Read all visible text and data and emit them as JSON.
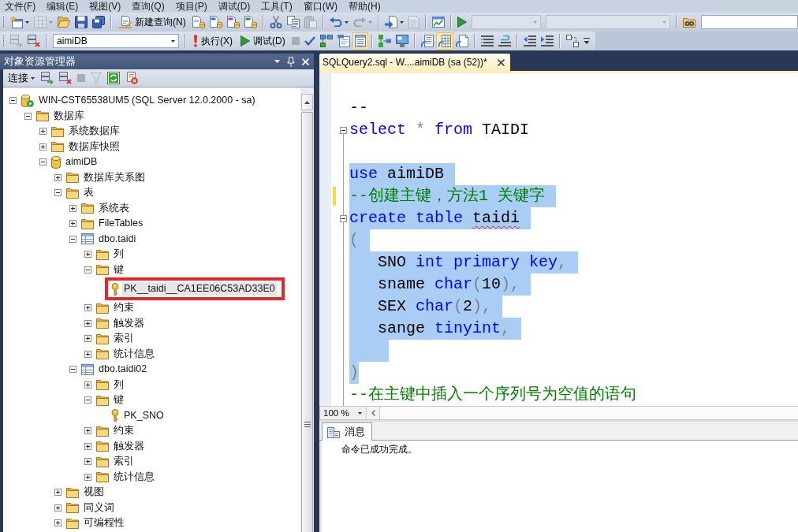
{
  "menu_bar": {
    "items": [
      "文件(F)",
      "编辑(E)",
      "视图(V)",
      "查询(Q)",
      "项目(P)",
      "调试(D)",
      "工具(T)",
      "窗口(W)",
      "帮助(H)"
    ]
  },
  "toolbar_1": {
    "items": [
      {
        "kind": "dropdown_icon",
        "disabled": false
      },
      {
        "kind": "dropdown_icon",
        "disabled": true
      },
      {
        "kind": "icon",
        "disabled": false
      },
      {
        "kind": "icon",
        "disabled": false
      },
      {
        "kind": "icon",
        "disabled": false
      },
      {
        "kind": "separator"
      },
      {
        "kind": "labeled",
        "label": "新建查询(N)",
        "disabled": false
      },
      {
        "kind": "icon",
        "disabled": false
      },
      {
        "kind": "icon",
        "disabled": false
      },
      {
        "kind": "icon",
        "disabled": false
      },
      {
        "kind": "icon",
        "disabled": false
      },
      {
        "kind": "separator"
      },
      {
        "kind": "icon",
        "disabled": false
      },
      {
        "kind": "icon",
        "disabled": false
      },
      {
        "kind": "icon",
        "disabled": true
      },
      {
        "kind": "separator"
      },
      {
        "kind": "dropdown_icon",
        "disabled": false
      },
      {
        "kind": "dropdown_icon",
        "disabled": true
      },
      {
        "kind": "separator"
      },
      {
        "kind": "dropdown_icon",
        "disabled": false
      },
      {
        "kind": "icon",
        "disabled": true
      },
      {
        "kind": "separator"
      },
      {
        "kind": "icon",
        "disabled": false
      },
      {
        "kind": "separator"
      },
      {
        "kind": "icon",
        "disabled": false
      },
      {
        "kind": "combo",
        "disabled": true
      },
      {
        "kind": "combo",
        "disabled": true
      },
      {
        "kind": "separator"
      },
      {
        "kind": "icon",
        "disabled": false
      },
      {
        "kind": "search"
      }
    ]
  },
  "toolbar_2": {
    "items": [
      {
        "kind": "icon",
        "disabled": true,
        "pressed": false
      },
      {
        "kind": "icon",
        "disabled": false,
        "pressed": false
      },
      {
        "kind": "separator"
      },
      {
        "kind": "combo",
        "value": "aimiDB",
        "disabled": false
      },
      {
        "kind": "separator"
      },
      {
        "kind": "labeled",
        "label": "执行(X)",
        "disabled": false
      },
      {
        "kind": "labeled",
        "label": "调试(D)",
        "disabled": false
      },
      {
        "kind": "icon",
        "disabled": true,
        "pressed": false
      },
      {
        "kind": "icon",
        "disabled": false,
        "pressed": false
      },
      {
        "kind": "icon",
        "disabled": false,
        "pressed": false
      },
      {
        "kind": "icon",
        "disabled": false,
        "pressed": false
      },
      {
        "kind": "icon",
        "disabled": false,
        "pressed": true
      },
      {
        "kind": "separator"
      },
      {
        "kind": "icon",
        "disabled": false,
        "pressed": false
      },
      {
        "kind": "icon",
        "disabled": false,
        "pressed": false
      },
      {
        "kind": "separator"
      },
      {
        "kind": "icon",
        "disabled": false,
        "pressed": false
      },
      {
        "kind": "icon",
        "disabled": false,
        "pressed": true
      },
      {
        "kind": "icon",
        "disabled": false,
        "pressed": false
      },
      {
        "kind": "separator"
      },
      {
        "kind": "icon",
        "disabled": false,
        "pressed": false
      },
      {
        "kind": "icon",
        "disabled": false,
        "pressed": false
      },
      {
        "kind": "separator"
      },
      {
        "kind": "icon",
        "disabled": false,
        "pressed": false
      },
      {
        "kind": "icon",
        "disabled": false,
        "pressed": false
      },
      {
        "kind": "separator"
      },
      {
        "kind": "icon",
        "disabled": false,
        "pressed": false
      },
      {
        "kind": "overflow"
      }
    ]
  },
  "object_explorer": {
    "title": "对象资源管理器",
    "connect": "连接",
    "buttons": [
      {
        "disabled": false
      },
      {
        "disabled": false
      },
      {
        "disabled": true
      },
      {
        "disabled": true
      },
      {
        "disabled": false
      },
      {
        "disabled": false
      }
    ],
    "tree": [
      {
        "label": "WIN-CST65538UM5 (SQL Server 12.0.2000 - sa)",
        "kind": "server",
        "expanded": true,
        "selected": false,
        "children": [
          {
            "label": "数据库",
            "kind": "folder",
            "expanded": true,
            "selected": false,
            "children": [
              {
                "label": "系统数据库",
                "kind": "folder",
                "expanded": false,
                "selected": false
              },
              {
                "label": "数据库快照",
                "kind": "folder",
                "expanded": false,
                "selected": false
              },
              {
                "label": "aimiDB",
                "kind": "database",
                "expanded": true,
                "selected": false,
                "children": [
                  {
                    "label": "数据库关系图",
                    "kind": "folder",
                    "expanded": false,
                    "selected": false
                  },
                  {
                    "label": "表",
                    "kind": "folder",
                    "expanded": true,
                    "selected": false,
                    "children": [
                      {
                        "label": "系统表",
                        "kind": "folder",
                        "expanded": false,
                        "selected": false
                      },
                      {
                        "label": "FileTables",
                        "kind": "folder",
                        "expanded": false,
                        "selected": false
                      },
                      {
                        "label": "dbo.taidi",
                        "kind": "table",
                        "expanded": true,
                        "selected": false,
                        "children": [
                          {
                            "label": "列",
                            "kind": "folder",
                            "expanded": false,
                            "selected": false
                          },
                          {
                            "label": "键",
                            "kind": "folder",
                            "expanded": true,
                            "selected": false,
                            "children": [
                              {
                                "label": "PK__taidi__CA1EE06C53AD33E0",
                                "kind": "key",
                                "selected": true,
                                "annotated": true
                              }
                            ]
                          },
                          {
                            "label": "约束",
                            "kind": "folder",
                            "expanded": false,
                            "selected": false
                          },
                          {
                            "label": "触发器",
                            "kind": "folder",
                            "expanded": false,
                            "selected": false
                          },
                          {
                            "label": "索引",
                            "kind": "folder",
                            "expanded": false,
                            "selected": false
                          },
                          {
                            "label": "统计信息",
                            "kind": "folder",
                            "expanded": false,
                            "selected": false
                          }
                        ]
                      },
                      {
                        "label": "dbo.taidi02",
                        "kind": "table",
                        "expanded": true,
                        "selected": false,
                        "children": [
                          {
                            "label": "列",
                            "kind": "folder",
                            "expanded": false,
                            "selected": false
                          },
                          {
                            "label": "键",
                            "kind": "folder",
                            "expanded": true,
                            "selected": false,
                            "children": [
                              {
                                "label": "PK_SNO",
                                "kind": "key",
                                "selected": false,
                                "annotated": false
                              }
                            ]
                          },
                          {
                            "label": "约束",
                            "kind": "folder",
                            "expanded": false,
                            "selected": false
                          },
                          {
                            "label": "触发器",
                            "kind": "folder",
                            "expanded": false,
                            "selected": false
                          },
                          {
                            "label": "索引",
                            "kind": "folder",
                            "expanded": false,
                            "selected": false
                          },
                          {
                            "label": "统计信息",
                            "kind": "folder",
                            "expanded": false,
                            "selected": false
                          }
                        ]
                      }
                    ]
                  },
                  {
                    "label": "视图",
                    "kind": "folder",
                    "expanded": false,
                    "selected": false
                  },
                  {
                    "label": "同义词",
                    "kind": "folder",
                    "expanded": false,
                    "selected": false
                  },
                  {
                    "label": "可编程性",
                    "kind": "folder",
                    "expanded": false,
                    "selected": false
                  }
                ]
              }
            ]
          }
        ]
      }
    ]
  },
  "editor": {
    "tabs": [
      {
        "title": "SQLQuery2.sql - W....aimiDB (sa (52))*",
        "selected": true
      }
    ],
    "lines": [
      {
        "selected": false,
        "changed": false,
        "fold": false,
        "tokens": [
          {
            "kind": "plain",
            "text": "--"
          }
        ]
      },
      {
        "selected": false,
        "changed": false,
        "fold": true,
        "tokens": [
          {
            "kind": "keyword",
            "text": "select"
          },
          {
            "kind": "op",
            "text": " *"
          },
          {
            "kind": "keyword",
            "text": " from"
          },
          {
            "kind": "ident",
            "text": " TAIDI"
          }
        ]
      },
      {
        "selected": false,
        "changed": false,
        "fold": false
      },
      {
        "selected": true,
        "changed": false,
        "fold": false,
        "tokens": [
          {
            "kind": "keyword",
            "text": "use"
          },
          {
            "kind": "ident",
            "text": " aimiDB"
          }
        ]
      },
      {
        "selected": true,
        "changed": true,
        "fold": false,
        "tokens": [
          {
            "kind": "comment",
            "text": "--创建主键，方法1 关键字"
          }
        ]
      },
      {
        "selected": true,
        "changed": false,
        "fold": true,
        "tokens": [
          {
            "kind": "keyword",
            "text": "create"
          },
          {
            "kind": "keyword",
            "text": " table "
          },
          {
            "kind": "error",
            "text": "taidi"
          }
        ]
      },
      {
        "selected": true,
        "changed": false,
        "fold": false,
        "tokens": [
          {
            "kind": "op",
            "text": "("
          }
        ]
      },
      {
        "selected": true,
        "changed": false,
        "fold": false,
        "tokens": [
          {
            "kind": "ident",
            "text": "   SNO"
          },
          {
            "kind": "keyword",
            "text": " int"
          },
          {
            "kind": "keyword",
            "text": " primary"
          },
          {
            "kind": "keyword",
            "text": " key"
          },
          {
            "kind": "op",
            "text": ","
          }
        ]
      },
      {
        "selected": true,
        "changed": false,
        "fold": false,
        "tokens": [
          {
            "kind": "ident",
            "text": "   sname"
          },
          {
            "kind": "keyword",
            "text": " char"
          },
          {
            "kind": "op",
            "text": "("
          },
          {
            "kind": "ident",
            "text": "10"
          },
          {
            "kind": "op",
            "text": "),"
          }
        ]
      },
      {
        "selected": true,
        "changed": false,
        "fold": false,
        "tokens": [
          {
            "kind": "ident",
            "text": "   SEX"
          },
          {
            "kind": "keyword",
            "text": " char"
          },
          {
            "kind": "op",
            "text": "("
          },
          {
            "kind": "ident",
            "text": "2"
          },
          {
            "kind": "op",
            "text": "),"
          }
        ]
      },
      {
        "selected": true,
        "changed": false,
        "fold": false,
        "tokens": [
          {
            "kind": "ident",
            "text": "   sange"
          },
          {
            "kind": "keyword",
            "text": " tinyint"
          },
          {
            "kind": "op",
            "text": ","
          }
        ]
      },
      {
        "selected": true,
        "changed": false,
        "fold": false
      },
      {
        "selected": true,
        "changed": false,
        "fold": false,
        "tokens": [
          {
            "kind": "op",
            "text": ")"
          }
        ]
      },
      {
        "selected": false,
        "changed": false,
        "fold": false,
        "tokens": [
          {
            "kind": "comment",
            "text": "--在主键中插入一个序列号为空值的语句"
          }
        ]
      }
    ],
    "zoom": "100 %"
  },
  "results": {
    "tabs": [
      {
        "label": "消息",
        "selected": true
      }
    ],
    "message": "命令已成功完成。"
  }
}
